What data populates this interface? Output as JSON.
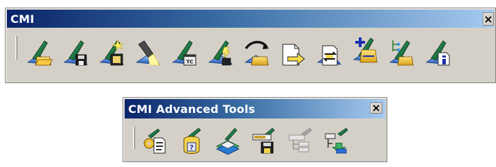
{
  "toolbars": {
    "cmi": {
      "title": "CMI",
      "buttons": [
        {
          "icon": "cmi-open-icon"
        },
        {
          "icon": "cmi-save-icon"
        },
        {
          "icon": "cmi-new-film-icon"
        },
        {
          "icon": "cmi-flashlight-icon"
        },
        {
          "icon": "cmi-tc-icon"
        },
        {
          "icon": "cmi-lightning-icon"
        },
        {
          "icon": "cmi-refresh-icon"
        },
        {
          "icon": "cmi-export-doc-icon"
        },
        {
          "icon": "cmi-sync-doc-icon"
        },
        {
          "icon": "cmi-add-folder-icon"
        },
        {
          "icon": "cmi-tree-folder-icon"
        },
        {
          "icon": "cmi-info-icon"
        }
      ]
    },
    "advanced": {
      "title": "CMI Advanced Tools",
      "buttons": [
        {
          "icon": "settings-doc-icon"
        },
        {
          "icon": "query-database-icon"
        },
        {
          "icon": "book-layers-icon"
        },
        {
          "icon": "save-form-icon"
        },
        {
          "icon": "disabled-tree-icon",
          "disabled": true
        },
        {
          "icon": "download-tree-icon"
        }
      ]
    }
  },
  "colors": {
    "titlebar_start": "#0a246a",
    "titlebar_end": "#a6caf0",
    "face": "#d4d0c8",
    "pen_dark": "#0a3b1c",
    "pen_light": "#3aa06a"
  }
}
